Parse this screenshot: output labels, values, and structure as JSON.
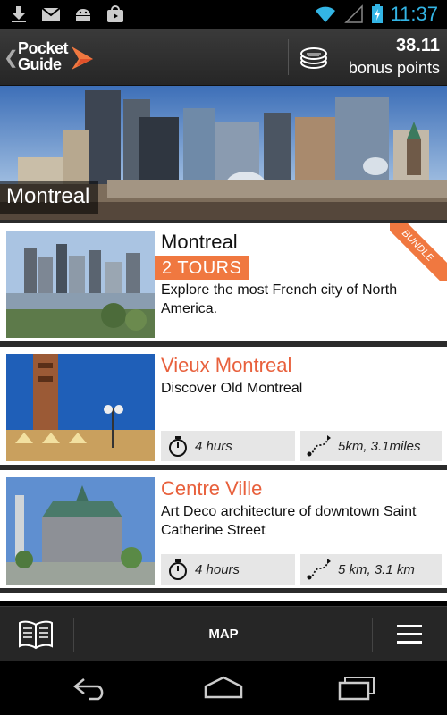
{
  "status_bar": {
    "time": "11:37",
    "notification_icons": [
      "download-icon",
      "gmail-icon",
      "android-icon",
      "store-icon"
    ],
    "system_icons": [
      "wifi-icon",
      "signal-icon",
      "battery-icon"
    ]
  },
  "app_bar": {
    "logo_line1": "Pocket",
    "logo_line2": "Guide",
    "points_value": "38.11",
    "points_label": "bonus points"
  },
  "hero": {
    "city": "Montreal"
  },
  "tours": [
    {
      "title": "Montreal",
      "badge": "2 TOURS",
      "ribbon": "BUNDLE",
      "description": "Explore the most French city of North America."
    },
    {
      "title": "Vieux Montreal",
      "description": "Discover Old Montreal",
      "duration": "4 hurs",
      "distance": "5km, 3.1miles"
    },
    {
      "title": "Centre Ville",
      "description": "Art Deco architecture of downtown Saint Catherine Street",
      "duration": "4 hours",
      "distance": "5 km, 3.1 km"
    }
  ],
  "bottom_bar": {
    "map_label": "MAP"
  },
  "colors": {
    "accent": "#f07840",
    "title_orange": "#e8603c",
    "clock_blue": "#33b5e5"
  }
}
